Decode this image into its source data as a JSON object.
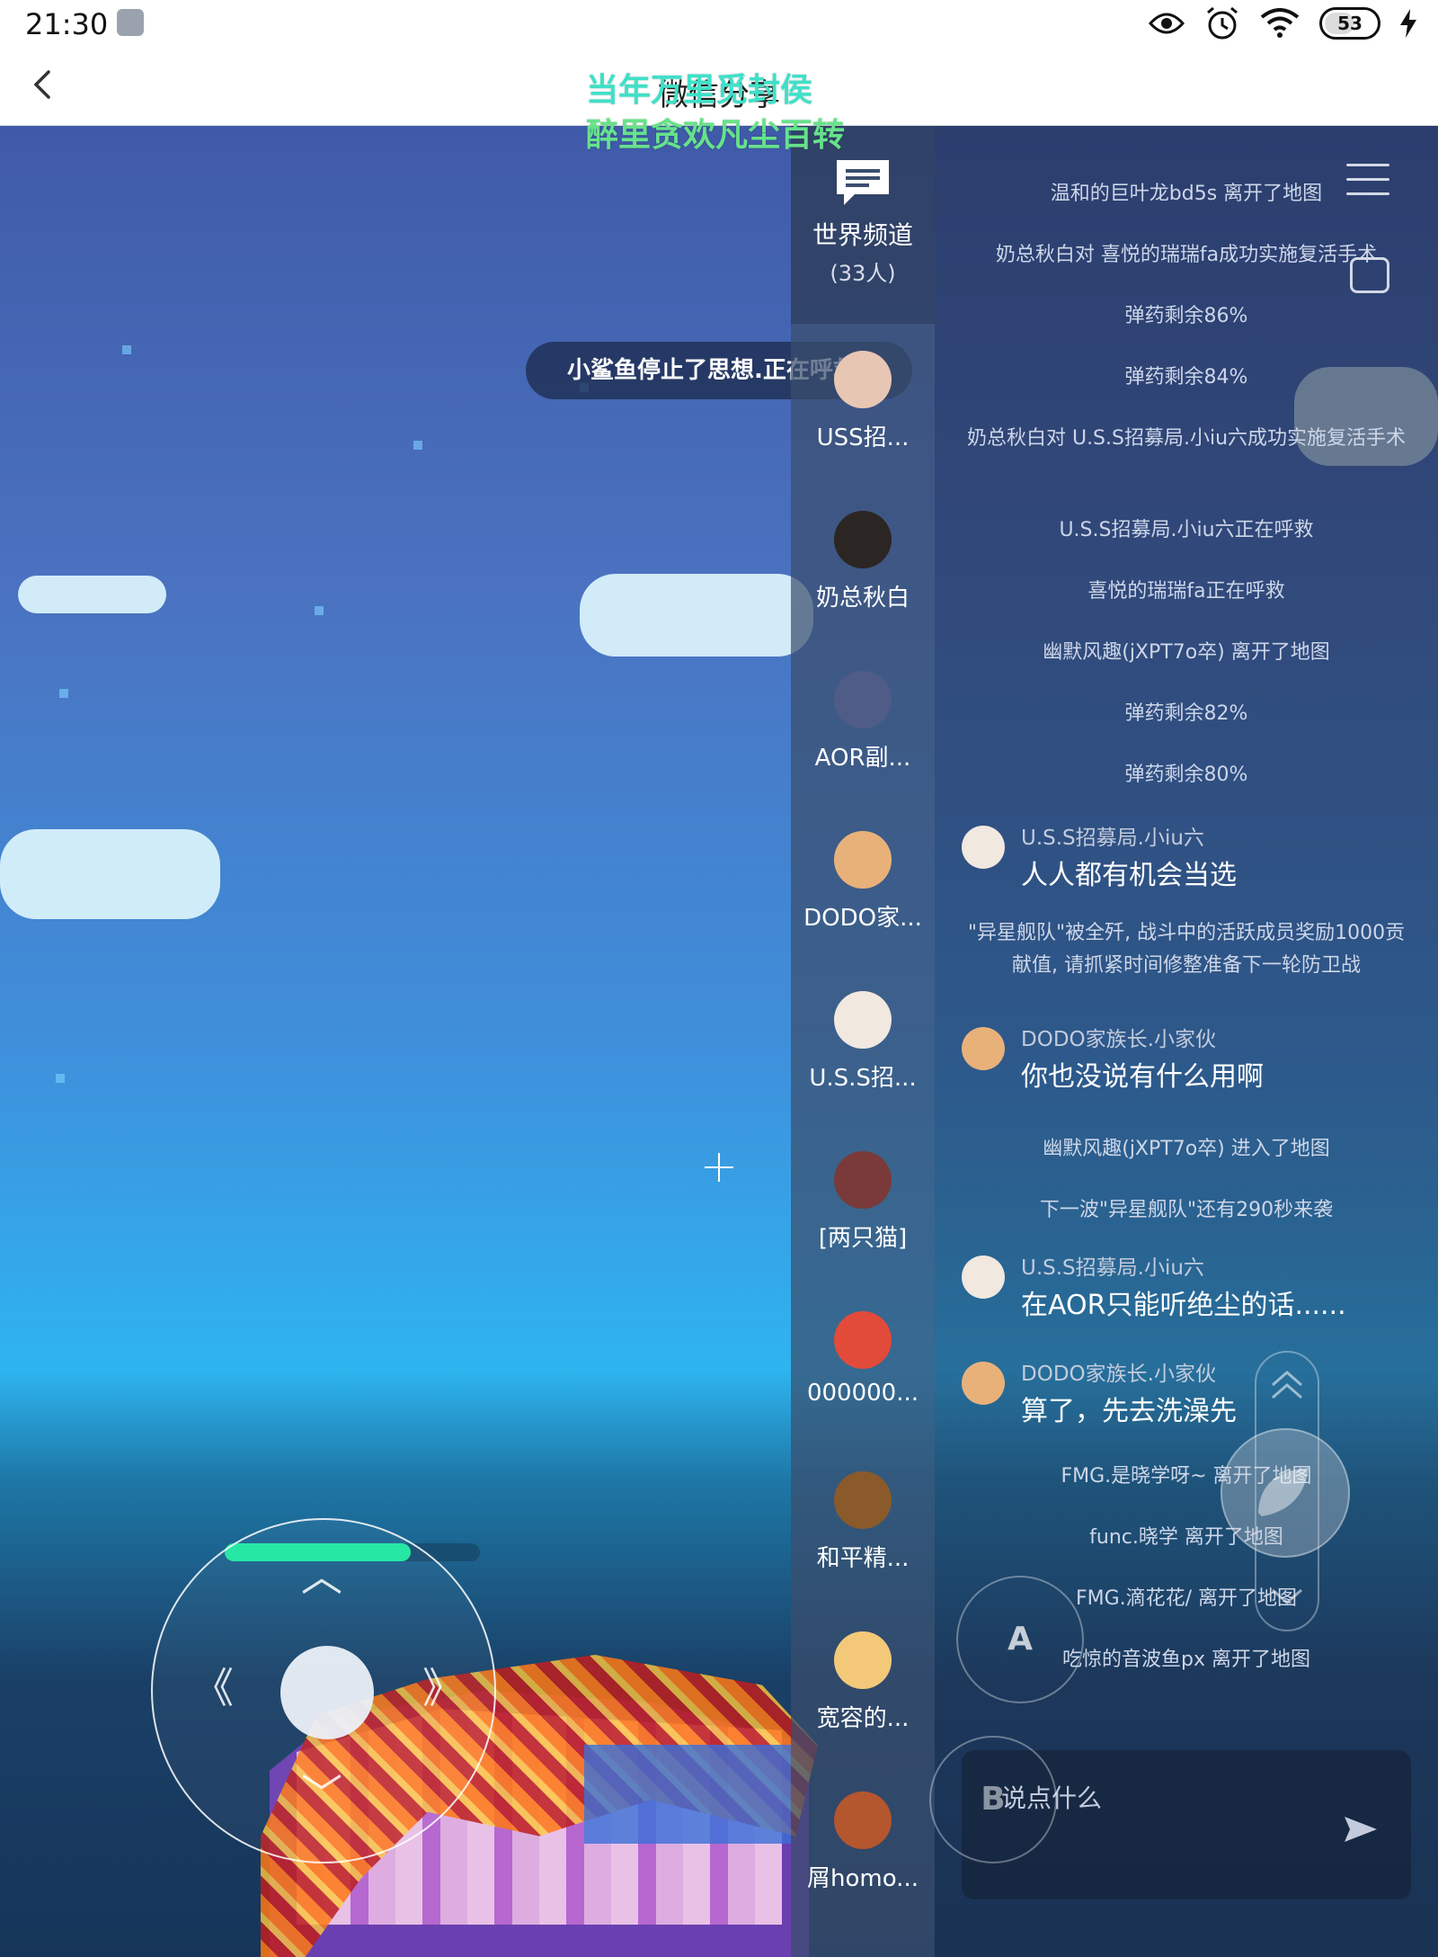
{
  "status_bar": {
    "time": "21:30",
    "battery": "53",
    "icons": [
      "scissors-app-icon",
      "eye-icon",
      "alarm-icon",
      "wifi-icon",
      "battery-icon",
      "charging-bolt-icon"
    ]
  },
  "header": {
    "title": "微信分享",
    "back_icon": "chevron-left-icon"
  },
  "lyrics": {
    "line1": "当年万里觅封侯",
    "line2": "醉里贪欢凡尘百转"
  },
  "toast": "小鲨鱼停止了思想.正在呼救",
  "hp_bar": {
    "fraction": 0.73,
    "color": "#1ee6a0"
  },
  "sidebar": {
    "world_channel": {
      "label": "世界频道",
      "count": "(33人)"
    },
    "conversations": [
      {
        "label": "USS招...",
        "avatar_color": "#e8c6b4"
      },
      {
        "label": "奶总秋白",
        "avatar_color": "#2b2623"
      },
      {
        "label": "AOR副...",
        "avatar_color": "#4f5c87"
      },
      {
        "label": "DODO家...",
        "avatar_color": "#e9b17a"
      },
      {
        "label": "U.S.S招...",
        "avatar_color": "#f1e8e0"
      },
      {
        "label": "[两只猫]",
        "avatar_color": "#7a3a3a"
      },
      {
        "label": "000000...",
        "avatar_color": "#e24a3a"
      },
      {
        "label": "和平精...",
        "avatar_color": "#8a5a2a"
      },
      {
        "label": "宽容的...",
        "avatar_color": "#f3c979"
      },
      {
        "label": "屑homo...",
        "avatar_color": "#b4562e"
      }
    ]
  },
  "messages": [
    {
      "type": "system",
      "text": "温和的巨叶龙bd5s 离开了地图"
    },
    {
      "type": "system",
      "text": "奶总秋白对 喜悦的瑞瑞fa成功实施复活手术"
    },
    {
      "type": "system",
      "text": "弹药剩余86%"
    },
    {
      "type": "system",
      "text": "弹药剩余84%"
    },
    {
      "type": "system",
      "text": "奶总秋白对 U.S.S招募局.小iu六成功实施复活手术"
    },
    {
      "type": "system",
      "text": "U.S.S招募局.小iu六正在呼救"
    },
    {
      "type": "system",
      "text": "喜悦的瑞瑞fa正在呼救"
    },
    {
      "type": "system",
      "text": "幽默风趣(jXPT7o卒) 离开了地图"
    },
    {
      "type": "system",
      "text": "弹药剩余82%"
    },
    {
      "type": "system",
      "text": "弹药剩余80%"
    },
    {
      "type": "user",
      "name": "U.S.S招募局.小iu六",
      "text": "人人都有机会当选",
      "avatar_color": "#f1e8e0"
    },
    {
      "type": "system",
      "text": "\"异星舰队\"被全歼, 战斗中的活跃成员奖励1000贡献值, 请抓紧时间修整准备下一轮防卫战"
    },
    {
      "type": "user",
      "name": "DODO家族长.小家伙",
      "text": "你也没说有什么用啊",
      "avatar_color": "#e9b17a"
    },
    {
      "type": "system",
      "text": "幽默风趣(jXPT7o卒) 进入了地图"
    },
    {
      "type": "system",
      "text": "下一波\"异星舰队\"还有290秒来袭"
    },
    {
      "type": "user",
      "name": "U.S.S招募局.小iu六",
      "text": "在AOR只能听绝尘的话......",
      "avatar_color": "#f1e8e0"
    },
    {
      "type": "user",
      "name": "DODO家族长.小家伙",
      "text": "算了，先去洗澡先",
      "avatar_color": "#e9b17a"
    },
    {
      "type": "system",
      "text": "FMG.是晓学呀~ 离开了地图"
    },
    {
      "type": "system",
      "text": "func.晓学 离开了地图"
    },
    {
      "type": "system",
      "text": "FMG.滴花花/ 离开了地图"
    },
    {
      "type": "system",
      "text": "吃惊的音波鱼px 离开了地图"
    }
  ],
  "chat_input": {
    "placeholder": "说点什么",
    "send_icon": "send-icon"
  },
  "controls": {
    "a_label": "A",
    "b_label": "B"
  }
}
